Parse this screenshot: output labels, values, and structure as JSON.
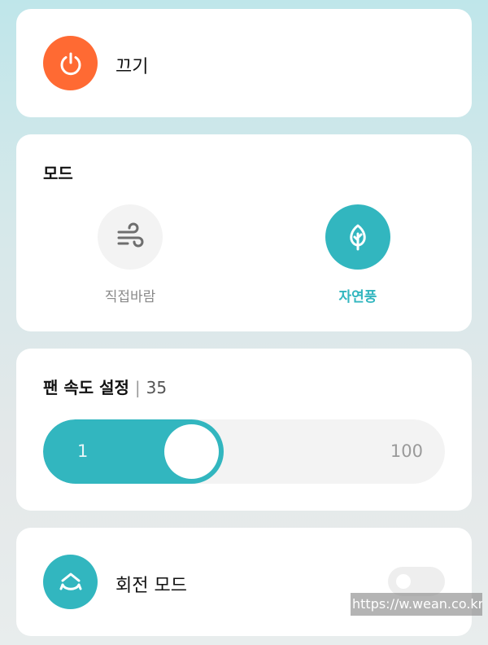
{
  "power": {
    "label": "끄기",
    "icon": "power-icon",
    "color": "#ff6a33"
  },
  "mode": {
    "title": "모드",
    "options": [
      {
        "label": "직접바람",
        "icon": "wind-icon",
        "selected": false
      },
      {
        "label": "자연풍",
        "icon": "leaf-icon",
        "selected": true
      }
    ],
    "selected_color": "#32b6bf"
  },
  "fan_speed": {
    "title": "팬 속도 설정",
    "separator": "|",
    "value_text": "35",
    "value": 35,
    "min_label": "1",
    "max_label": "100",
    "min": 1,
    "max": 100
  },
  "rotation": {
    "label": "회전 모드",
    "icon": "rotate-icon",
    "enabled": false
  },
  "watermark": {
    "text": "https://w.wean.co.kr"
  }
}
